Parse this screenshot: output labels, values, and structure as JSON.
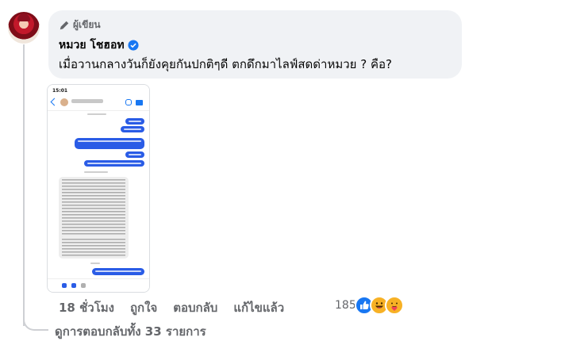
{
  "comment": {
    "badge_label": "ผู้เขียน",
    "author_name": "หมวย โชฮอท",
    "text": "เมื่อวานกลางวันก็ยังคุยกันปกติๆดี ตกดึกมาไลฟ์สดด่าหมวย ? คือ?"
  },
  "actions": {
    "timestamp": "18 ชั่วโมง",
    "like_label": "ถูกใจ",
    "reply_label": "ตอบกลับ",
    "edited_label": "แก้ไขแล้ว"
  },
  "reactions": {
    "count": "185",
    "icons": [
      "like-icon",
      "haha-icon",
      "care-icon"
    ]
  },
  "replies": {
    "view_all_label": "ดูการตอบกลับทั้ง 33 รายการ"
  },
  "attachment": {
    "status_time": "15:01"
  },
  "colors": {
    "bubble_bg": "#f0f2f5",
    "secondary_text": "#65676b",
    "verified": "#1877f2",
    "messenger_blue": "#2a5ce6"
  }
}
